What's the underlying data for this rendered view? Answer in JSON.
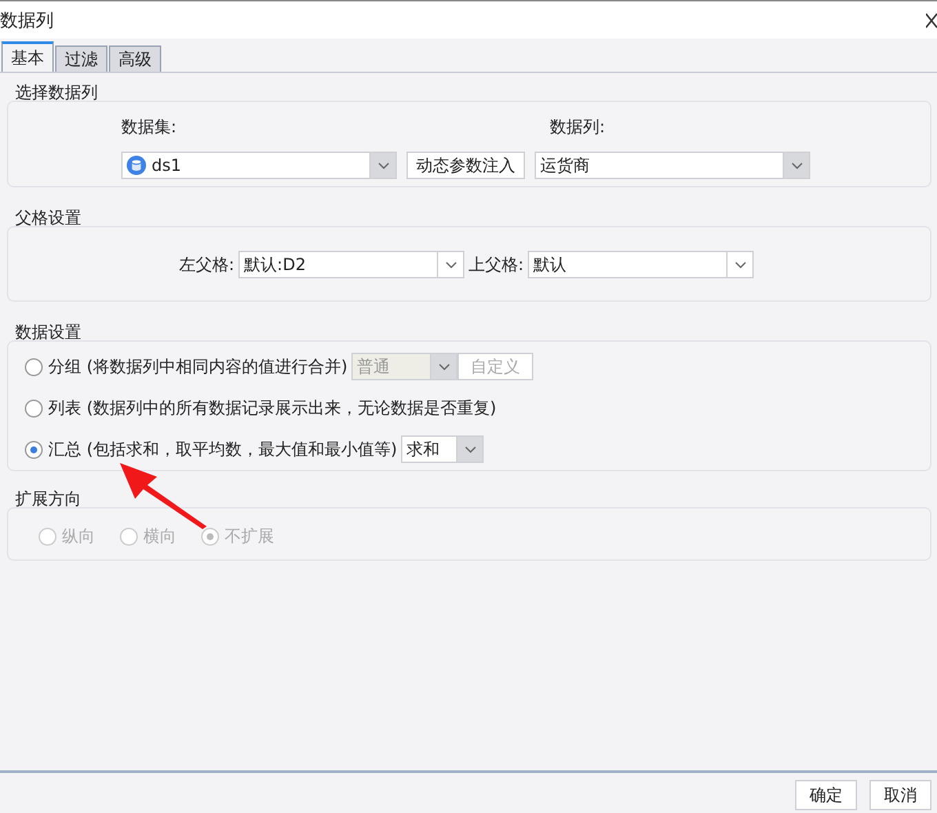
{
  "window": {
    "title": "数据列"
  },
  "tabs": [
    {
      "label": "基本",
      "selected": true
    },
    {
      "label": "过滤",
      "selected": false
    },
    {
      "label": "高级",
      "selected": false
    }
  ],
  "select_column": {
    "title": "选择数据列",
    "dataset_label": "数据集:",
    "dataset": "ds1",
    "inject_button": "动态参数注入",
    "column_label": "数据列:",
    "column": "运货商"
  },
  "parent_settings": {
    "title": "父格设置",
    "left_label": "左父格:",
    "left_value": "默认:D2",
    "top_label": "上父格:",
    "top_value": "默认"
  },
  "data_settings": {
    "title": "数据设置",
    "options": [
      {
        "kind": "group",
        "label": "分组",
        "description": "(将数据列中相同内容的值进行合并)",
        "selected": false,
        "combo": "普通",
        "button": "自定义"
      },
      {
        "kind": "list",
        "label": "列表",
        "description": "(数据列中的所有数据记录展示出来，无论数据是否重复)",
        "selected": false
      },
      {
        "kind": "summary",
        "label": "汇总",
        "description": "(包括求和，取平均数，最大值和最小值等)",
        "selected": true,
        "combo": "求和"
      }
    ]
  },
  "expand_direction": {
    "title": "扩展方向",
    "disabled": true,
    "options": [
      {
        "label": "纵向",
        "selected": false
      },
      {
        "label": "横向",
        "selected": false
      },
      {
        "label": "不扩展",
        "selected": true
      }
    ]
  },
  "buttons": [
    "确定",
    "取消"
  ]
}
